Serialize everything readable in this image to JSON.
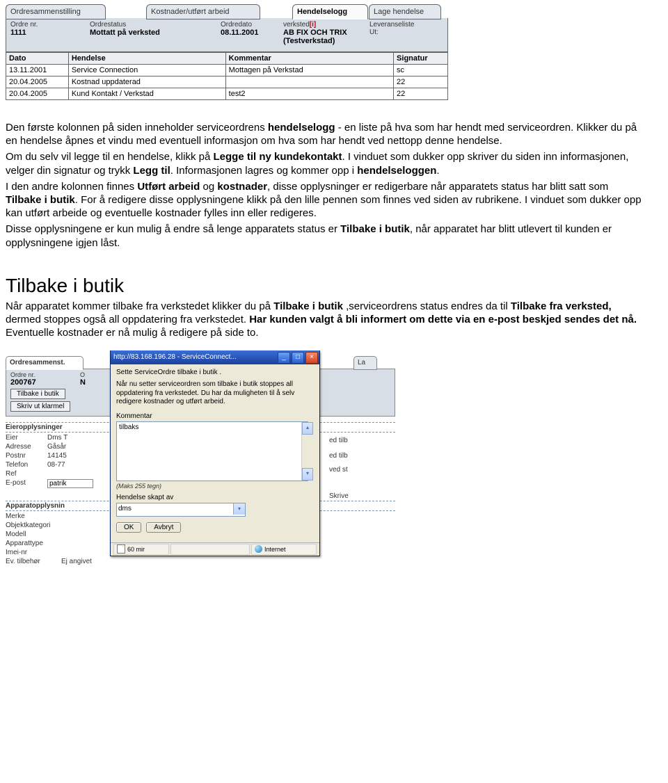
{
  "shot1": {
    "tabs": {
      "ordresammenstilling": "Ordresammenstilling",
      "kostnader": "Kostnader/utført arbeid",
      "hendelselogg": "Hendelselogg",
      "lage_hendelse": "Lage hendelse"
    },
    "infobar": {
      "ordre_nr_label": "Ordre nr.",
      "ordre_nr": "1111",
      "ordrestatus_label": "Ordrestatus",
      "ordrestatus": "Mottatt på verksted",
      "ordredato_label": "Ordredato",
      "ordredato": "08.11.2001",
      "verksted_label_a": "verksted",
      "verksted_label_b": "[i]",
      "verksted": "AB FIX OCH TRIX (Testverkstad)",
      "leveranseliste_label": "Leveranseliste",
      "ut_label": "Ut:"
    },
    "table": {
      "headers": {
        "dato": "Dato",
        "hendelse": "Hendelse",
        "kommentar": "Kommentar",
        "signatur": "Signatur"
      },
      "rows": [
        {
          "dato": "13.11.2001",
          "hendelse": "Service Connection",
          "kommentar": "Mottagen på Verkstad",
          "signatur": "sc"
        },
        {
          "dato": "20.04.2005",
          "hendelse": "Kostnad uppdaterad",
          "kommentar": "",
          "signatur": "22"
        },
        {
          "dato": "20.04.2005",
          "hendelse": "Kund Kontakt / Verkstad",
          "kommentar": "test2",
          "signatur": "22"
        }
      ]
    }
  },
  "bodytext": {
    "p1a": "Den første kolonnen på siden inneholder serviceordrens ",
    "p1b": "hendelselogg",
    "p1c": " - en liste på hva som har hendt med serviceordren. Klikker du på en hendelse åpnes et vindu med eventuell informasjon om hva som har hendt ved nettopp denne hendelse.",
    "p2a": "Om du selv vil legge til en hendelse, klikk på ",
    "p2b": "Legge til ny kundekontakt",
    "p2c": ". I vinduet som dukker opp skriver du siden inn informasjonen, velger din signatur og trykk ",
    "p2d": "Legg til",
    "p2e": ". Informasjonen lagres og kommer opp i ",
    "p2f": "hendelseloggen",
    "p2g": ".",
    "p3a": "I den andre kolonnen finnes ",
    "p3b": "Utført arbeid",
    "p3c": " og ",
    "p3d": "kostnader",
    "p3e": ", disse opplysninger er redigerbare når apparatets status har blitt satt som ",
    "p3f": "Tilbake i butik",
    "p3g": ". For å redigere disse opplysningene klikk på den lille pennen som finnes ved siden av rubrikene. I vinduet som dukker opp kan utført arbeide og eventuelle kostnader fylles inn eller redigeres.",
    "p4a": "Disse opplysningene er kun mulig å endre så lenge apparatets status er ",
    "p4b": "Tilbake i butik",
    "p4c": ", når apparatet har blitt utlevert til kunden er opplysningene igjen låst."
  },
  "section2": {
    "title": "Tilbake i butik",
    "p1a": "Når apparatet kommer tilbake fra verkstedet klikker du på ",
    "p1b": "Tilbake i butik",
    "p1c": " ,serviceordrens status endres da til ",
    "p1d": "Tilbake fra verksted,",
    "p1e": " dermed stoppes også all oppdatering fra verkstedet. ",
    "p1f": "Har kunden valgt å bli informert om dette via en e-post beskjed sendes det nå.",
    "p1g": " Eventuelle kostnader er nå mulig å redigere på side to."
  },
  "shot2": {
    "bg": {
      "tab_ord": "Ordresammenst.",
      "tab_la": "La",
      "ordre_nr_label": "Ordre nr.",
      "ordre_nr": "200767",
      "ordrestatus_label": "O",
      "ordrestatus": "N",
      "btn_tilbake": "Tilbake i butik",
      "btn_skriv": "Skriv ut klarmel",
      "grp_eier": "Eieropplysninger",
      "eier_l": "Eier",
      "eier_v": "Dms T",
      "adresse_l": "Adresse",
      "adresse_v": "Gåsår",
      "postnr_l": "Postnr",
      "postnr_v": "14145",
      "telefon_l": "Telefon",
      "telefon_v": "08-77",
      "ref_l": "Ref",
      "epost_l": "E-post",
      "epost_v": "patrik",
      "grp_app": "Apparatopplysnin",
      "merke_l": "Merke",
      "objkat_l": "Objektkategori",
      "modell_l": "Modell",
      "apptype_l": "Apparattype",
      "imei_l": "Imei-nr",
      "evtil_l": "Ev. tilbehør",
      "evtil_v": "Ej angivet",
      "right_edtilb1": "ed tilb",
      "right_edtilb2": "ed tilb",
      "right_vedst": "ved st",
      "right_skrive": "Skrive"
    },
    "dlg": {
      "title": "http://83.168.196.28 - ServiceConnect...",
      "head": "Sette ServiceOrdre tilbake i butik .",
      "para": "Når nu setter serviceordren som tilbake i butik stoppes all oppdatering fra verkstedet.\nDu har da muligheten til å selv redigere kostnader og utført arbeid.",
      "kommentar_l": "Kommentar",
      "kommentar_v": "tilbaks",
      "maks": "(Maks 255 tegn)",
      "skapt_l": "Hendelse skapt av",
      "skapt_v": "dms",
      "ok": "OK",
      "avbryt": "Avbryt",
      "sb_left": "60 mir",
      "sb_right": "Internet"
    }
  }
}
